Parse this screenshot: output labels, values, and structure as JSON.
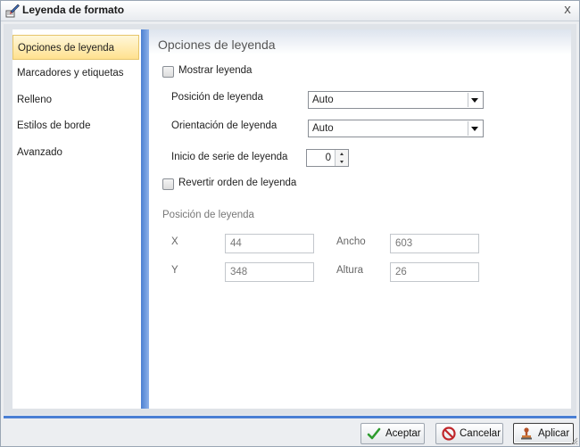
{
  "window": {
    "title": "Leyenda de formato",
    "close_glyph": "x"
  },
  "nav": {
    "items": [
      {
        "label": "Opciones de leyenda",
        "active": true
      },
      {
        "label": "Marcadores y etiquetas",
        "active": false
      },
      {
        "label": "Relleno",
        "active": false
      },
      {
        "label": "Estilos de borde",
        "active": false
      },
      {
        "label": "Avanzado",
        "active": false
      }
    ]
  },
  "panel": {
    "title": "Opciones de leyenda",
    "show_legend": {
      "label": "Mostrar leyenda",
      "checked": false
    },
    "position": {
      "label": "Posición de leyenda",
      "value": "Auto"
    },
    "orientation": {
      "label": "Orientación de leyenda",
      "value": "Auto"
    },
    "series_start": {
      "label": "Inicio de serie de leyenda",
      "value": "0"
    },
    "reverse_order": {
      "label": "Revertir orden de leyenda",
      "checked": false
    },
    "position_section": {
      "title": "Posición de leyenda",
      "x_label": "X",
      "x_value": "44",
      "y_label": "Y",
      "y_value": "348",
      "width_label": "Ancho",
      "width_value": "603",
      "height_label": "Altura",
      "height_value": "26"
    }
  },
  "footer": {
    "accept": "Aceptar",
    "cancel": "Cancelar",
    "apply": "Aplicar"
  },
  "colors": {
    "accent_bar": "#4a7fd4",
    "nav_active": "#ffe18f"
  },
  "icons": {
    "title": "format-legend-icon",
    "accept": "check-icon",
    "cancel": "no-entry-icon",
    "apply": "stamp-icon"
  }
}
